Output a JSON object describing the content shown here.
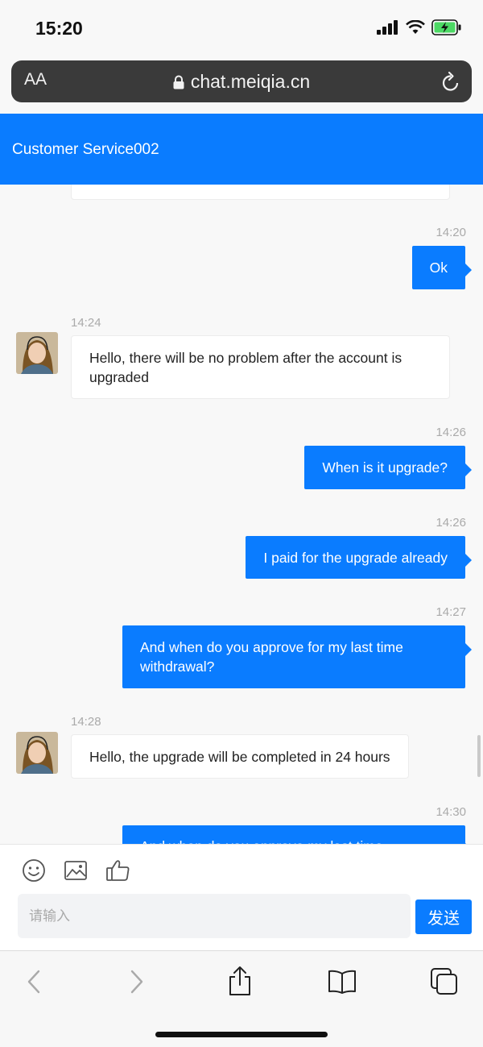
{
  "status_bar": {
    "time": "15:20",
    "battery": "charging"
  },
  "url_bar": {
    "text_size_label": "AA",
    "domain": "chat.meiqia.cn"
  },
  "chat": {
    "title": "Customer Service002"
  },
  "messages": [
    {
      "sender": "user",
      "time": "14:20",
      "text": "Ok"
    },
    {
      "sender": "agent",
      "time": "14:24",
      "text": "Hello, there will be no problem after the account is upgraded"
    },
    {
      "sender": "user",
      "time": "14:26",
      "text": "When is it upgrade?"
    },
    {
      "sender": "user",
      "time": "14:26",
      "text": "I paid for the upgrade already"
    },
    {
      "sender": "user",
      "time": "14:27",
      "text": "And when do you approve for my last time withdrawal?"
    },
    {
      "sender": "agent",
      "time": "14:28",
      "text": "Hello, the upgrade will be completed in 24 hours"
    },
    {
      "sender": "user",
      "time": "14:30",
      "text": "And when do you approve my last time"
    }
  ],
  "composer": {
    "placeholder": "请输入",
    "send_label": "发送"
  },
  "colors": {
    "accent": "#0a7cff",
    "background": "#f8f8f8"
  }
}
